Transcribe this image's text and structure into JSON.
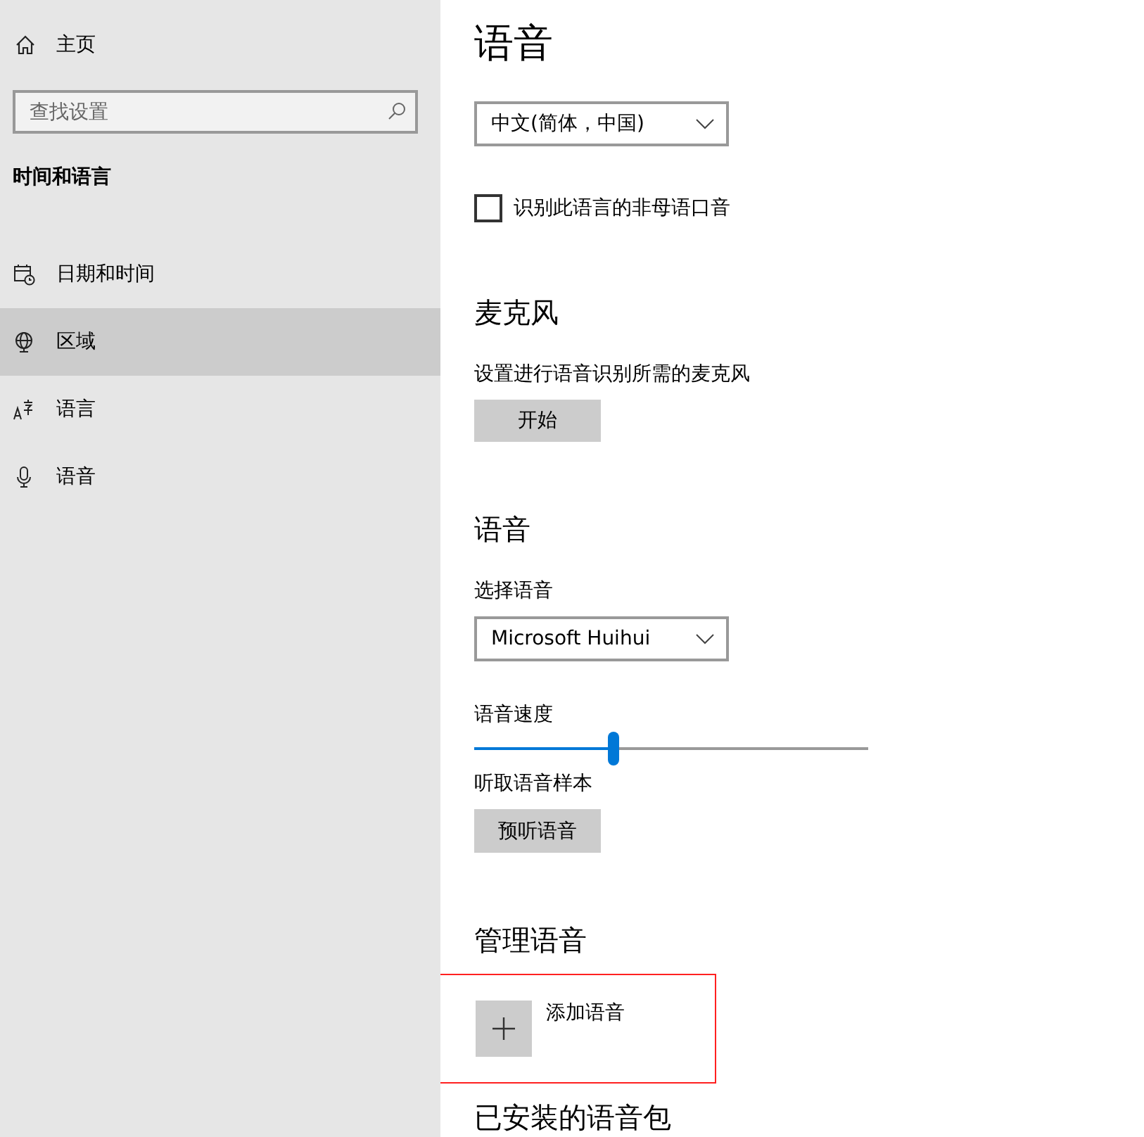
{
  "sidebar": {
    "home": {
      "label": "主页"
    },
    "search": {
      "placeholder": "查找设置"
    },
    "section_title": "时间和语言",
    "items": [
      {
        "label": "日期和时间",
        "selected": false
      },
      {
        "label": "区域",
        "selected": true
      },
      {
        "label": "语言",
        "selected": false
      },
      {
        "label": "语音",
        "selected": false
      }
    ]
  },
  "page": {
    "title": "语音",
    "language_dropdown": {
      "value": "中文(简体，中国)"
    },
    "accent_checkbox": {
      "label": "识别此语言的非母语口音",
      "checked": false
    },
    "microphone": {
      "heading": "麦克风",
      "description": "设置进行语音识别所需的麦克风",
      "button": "开始"
    },
    "voice": {
      "heading": "语音",
      "select_label": "选择语音",
      "dropdown": {
        "value": "Microsoft Huihui"
      },
      "speed_label": "语音速度",
      "speed": {
        "level": 0.354
      },
      "sample_label": "听取语音样本",
      "preview_button": "预听语音"
    },
    "manage": {
      "heading": "管理语音",
      "add_label": "添加语音",
      "highlighted": true
    },
    "installed_heading": "已安装的语音包"
  }
}
